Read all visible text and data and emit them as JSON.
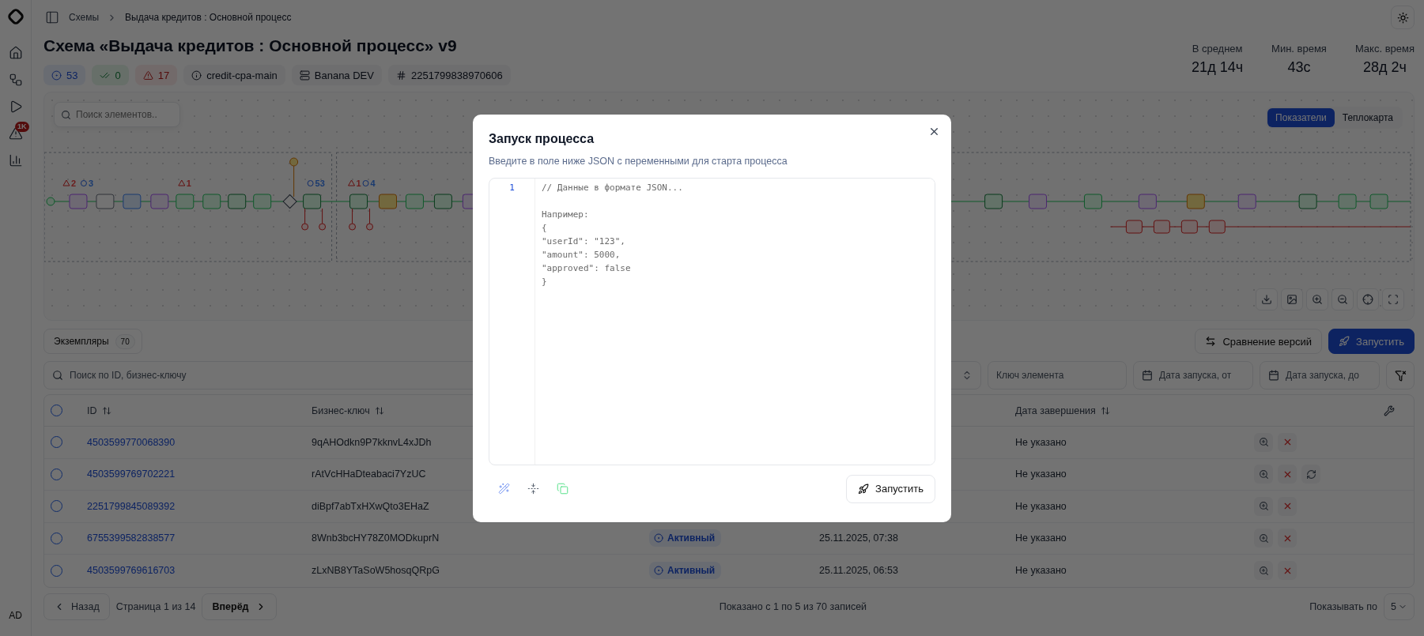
{
  "sidebar": {
    "items": [
      {
        "kind": "home"
      },
      {
        "kind": "schemes"
      },
      {
        "kind": "run"
      },
      {
        "kind": "alerts",
        "badge": "1K"
      },
      {
        "kind": "stats"
      }
    ],
    "user": "AD"
  },
  "breadcrumbs": [
    "Схемы",
    "Выдача кредитов : Основной процесс"
  ],
  "title": "Схема «Выдача кредитов : Основной процесс» v9",
  "chips": [
    {
      "kind": "active",
      "text": "53"
    },
    {
      "kind": "done",
      "text": "0"
    },
    {
      "kind": "error",
      "text": "17"
    },
    {
      "kind": "info",
      "text": "credit-cpa-main"
    },
    {
      "kind": "server",
      "text": "Banana DEV"
    },
    {
      "kind": "hash",
      "text": "2251799838970606"
    }
  ],
  "stats": [
    {
      "label": "В среднем",
      "value": "21д 14ч"
    },
    {
      "label": "Мин. время",
      "value": "43с"
    },
    {
      "label": "Макс. время",
      "value": "28д 2ч"
    }
  ],
  "diagram": {
    "search_placeholder": "Поиск элементов..",
    "modes": [
      {
        "label": "Показатели",
        "selected": true
      },
      {
        "label": "Теплокарта",
        "selected": false
      }
    ],
    "badges": [
      {
        "kind": "warning",
        "text": "2"
      },
      {
        "kind": "info",
        "text": "3"
      },
      {
        "kind": "warning",
        "text": "1"
      },
      {
        "kind": "info",
        "text": "53"
      },
      {
        "kind": "warning",
        "text": "1"
      },
      {
        "kind": "info",
        "text": "4"
      }
    ],
    "tools": [
      {
        "kind": "download"
      },
      {
        "kind": "image"
      },
      {
        "kind": "zoom-in"
      },
      {
        "kind": "zoom-out"
      },
      {
        "kind": "locate"
      },
      {
        "kind": "fit"
      }
    ]
  },
  "instances": {
    "tab": "Экземпляры",
    "count": "70"
  },
  "actions": [
    {
      "kind": "compare",
      "label": "Сравнение версий"
    },
    {
      "kind": "launch",
      "label": "Запустить"
    }
  ],
  "filters": {
    "search_placeholder": "Поиск по ID, бизнес-ключу",
    "element_key_placeholder": "Ключ элемента",
    "date_from_placeholder": "Дата запуска, от",
    "date_to_placeholder": "Дата запуска, до"
  },
  "table": {
    "all_selected": false,
    "columns": [
      {
        "label": "ID"
      },
      {
        "label": "Бизнес-ключ"
      },
      {
        "label": "Дата завершения"
      }
    ],
    "rows": [
      {
        "selected": false,
        "id": "4503599770068390",
        "business_key": "9qAHOdkn9P7kknvL4xJDh",
        "finished": "Не указано",
        "actions": [
          {
            "kind": "inspect"
          },
          {
            "kind": "cancel"
          }
        ]
      },
      {
        "selected": false,
        "id": "4503599769702221",
        "business_key": "rAtVcHHaDteabaci7YzUC",
        "finished": "Не указано",
        "actions": [
          {
            "kind": "inspect"
          },
          {
            "kind": "cancel"
          },
          {
            "kind": "retry"
          }
        ]
      },
      {
        "selected": false,
        "id": "2251799845089392",
        "business_key": "diBpf7abTxHXwQto3EHaZ",
        "finished": "Не указано",
        "actions": [
          {
            "kind": "inspect"
          },
          {
            "kind": "cancel"
          }
        ]
      },
      {
        "selected": false,
        "id": "6755399582838577",
        "business_key": "8Wnb3bcHY78Z0MODkuprN",
        "status": "Активный",
        "started": "25.11.2025, 07:38",
        "finished": "Не указано",
        "actions": [
          {
            "kind": "inspect"
          },
          {
            "kind": "cancel"
          }
        ]
      },
      {
        "selected": false,
        "id": "4503599769616703",
        "business_key": "zLxNB8YTaSoW5hosqQRpG",
        "status": "Активный",
        "started": "25.11.2025, 06:53",
        "finished": "Не указано",
        "actions": [
          {
            "kind": "inspect"
          },
          {
            "kind": "cancel"
          }
        ]
      }
    ]
  },
  "pagination": {
    "prev": "Назад",
    "page": "Страница 1 из 14",
    "next": "Вперёд",
    "summary": "Показано с 1 по 5 из 70 записей",
    "page_size_label": "Показывать по",
    "page_size": "5"
  },
  "modal": {
    "title": "Запуск процесса",
    "description": "Введите в поле ниже JSON с переменными для старта процесса",
    "line_numbers": [
      "1"
    ],
    "placeholder": "// Данные в формате JSON...\n\nНапример:\n{\n\"userId\": \"123\",\n\"amount\": 5000,\n\"approved\": false\n}",
    "tools": [
      {
        "kind": "format"
      },
      {
        "kind": "compact"
      },
      {
        "kind": "copy"
      }
    ],
    "submit": "Запустить"
  }
}
